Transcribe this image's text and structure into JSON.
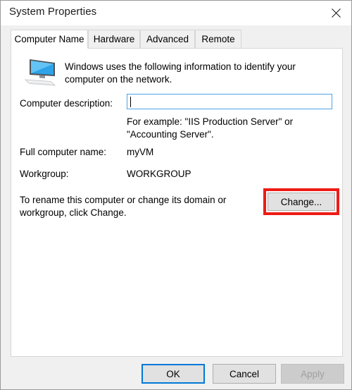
{
  "window": {
    "title": "System Properties",
    "close_icon": "close-icon"
  },
  "tabs": [
    {
      "label": "Computer Name",
      "active": true
    },
    {
      "label": "Hardware",
      "active": false
    },
    {
      "label": "Advanced",
      "active": false
    },
    {
      "label": "Remote",
      "active": false
    }
  ],
  "panel": {
    "icon": "computer-monitor-icon",
    "intro_text": "Windows uses the following information to identify your computer on the network.",
    "computer_description": {
      "label": "Computer description:",
      "value": "",
      "placeholder": ""
    },
    "example_text": "For example: \"IIS Production Server\" or \"Accounting Server\".",
    "full_computer_name": {
      "label": "Full computer name:",
      "value": "myVM"
    },
    "workgroup": {
      "label": "Workgroup:",
      "value": "WORKGROUP"
    },
    "rename_text": "To rename this computer or change its domain or workgroup, click Change.",
    "change_button": "Change..."
  },
  "footer": {
    "ok": "OK",
    "cancel": "Cancel",
    "apply": "Apply"
  },
  "colors": {
    "accent": "#0078d7",
    "annotation": "#ee1b16",
    "input_focus_border": "#4da3e8",
    "window_bg": "#f0f0f0",
    "panel_bg": "#ffffff"
  }
}
